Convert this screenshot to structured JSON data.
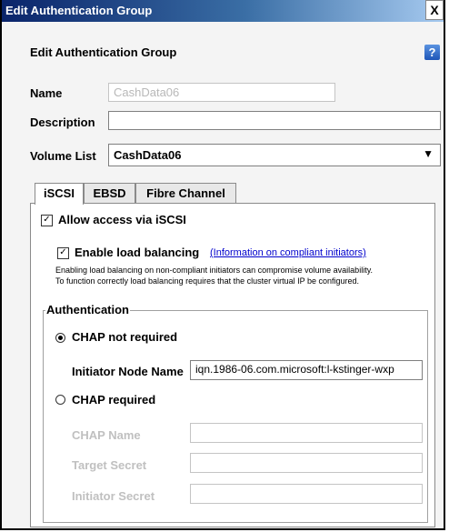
{
  "window": {
    "title": "Edit Authentication Group",
    "close_label": "X"
  },
  "header": {
    "title": "Edit Authentication Group",
    "help_label": "?"
  },
  "form": {
    "name_label": "Name",
    "name_value": "CashData06",
    "description_label": "Description",
    "description_value": "",
    "volume_list_label": "Volume List",
    "volume_list_value": "CashData06"
  },
  "tabs": [
    "iSCSI",
    "EBSD",
    "Fibre Channel"
  ],
  "iscsi": {
    "allow_access_label": "Allow access via iSCSI",
    "allow_access_checked": true,
    "load_balancing_label": "Enable load balancing",
    "load_balancing_checked": true,
    "load_balancing_link": "(Information on compliant initiators)",
    "note_line1": "Enabling load balancing on non-compliant initiators can compromise volume availability.",
    "note_line2": "To function correctly load balancing requires that the cluster virtual IP be configured.",
    "authentication": {
      "legend": "Authentication",
      "chap_not_required_label": "CHAP not required",
      "chap_not_required_selected": true,
      "initiator_node_name_label": "Initiator Node Name",
      "initiator_node_name_value": "iqn.1986-06.com.microsoft:l-kstinger-wxp",
      "chap_required_label": "CHAP required",
      "chap_required_selected": false,
      "chap_name_label": "CHAP Name",
      "target_secret_label": "Target Secret",
      "initiator_secret_label": "Initiator Secret"
    }
  },
  "icons": {
    "help": "help-icon",
    "dropdown": "chevron-down-icon",
    "close": "close-icon"
  }
}
